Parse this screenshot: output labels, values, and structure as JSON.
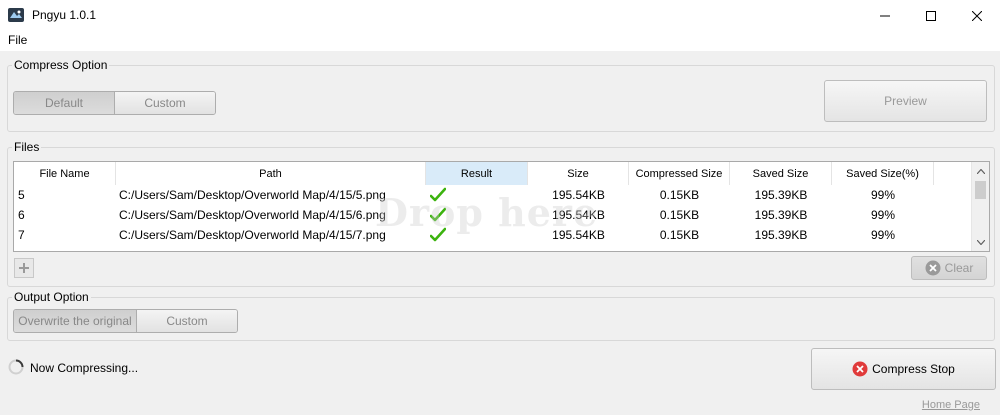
{
  "window": {
    "title": "Pngyu 1.0.1"
  },
  "menu": {
    "file_label": "File"
  },
  "compress_option": {
    "label": "Compress Option",
    "modes": [
      "Default",
      "Custom"
    ],
    "preview_label": "Preview"
  },
  "files": {
    "label": "Files",
    "columns": [
      "File Name",
      "Path",
      "Result",
      "Size",
      "Compressed Size",
      "Saved Size",
      "Saved Size(%)"
    ],
    "rows": [
      {
        "name": "5",
        "path": "C:/Users/Sam/Desktop/Overworld Map/4/15/5.png",
        "result": "done",
        "size": "195.54KB",
        "compressed": "0.15KB",
        "saved": "195.39KB",
        "pct": "99%"
      },
      {
        "name": "6",
        "path": "C:/Users/Sam/Desktop/Overworld Map/4/15/6.png",
        "result": "done",
        "size": "195.54KB",
        "compressed": "0.15KB",
        "saved": "195.39KB",
        "pct": "99%"
      },
      {
        "name": "7",
        "path": "C:/Users/Sam/Desktop/Overworld Map/4/15/7.png",
        "result": "done",
        "size": "195.54KB",
        "compressed": "0.15KB",
        "saved": "195.39KB",
        "pct": "99%"
      }
    ],
    "watermark": "Drop here",
    "clear_label": "Clear"
  },
  "output_option": {
    "label": "Output Option",
    "modes": [
      "Overwrite the original",
      "Custom"
    ]
  },
  "status": {
    "text": "Now Compressing..."
  },
  "actions": {
    "compress_stop_label": "Compress Stop"
  },
  "footer": {
    "home_link": "Home Page"
  },
  "colors": {
    "check": "#3cb30f",
    "stop": "#e03a3a",
    "header_selected": "#d9ebf9"
  }
}
